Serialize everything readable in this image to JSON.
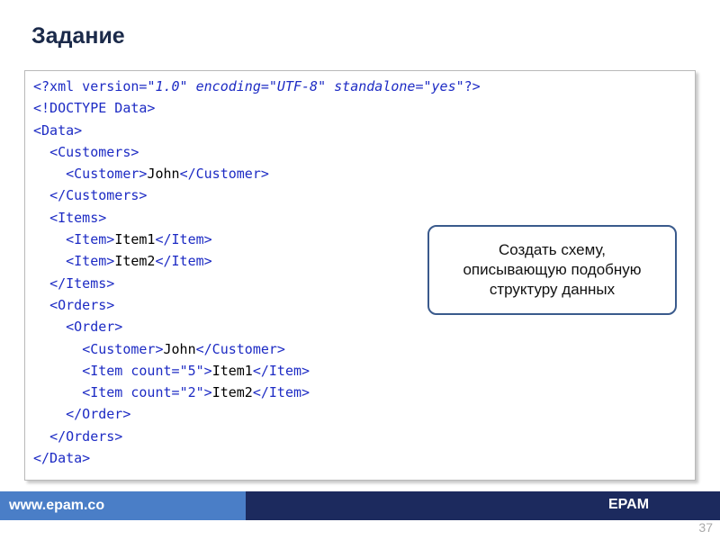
{
  "slide": {
    "title": "Задание",
    "page_number": "37"
  },
  "code": {
    "lines": [
      [
        {
          "t": "<?xml version=",
          "c": "tag"
        },
        {
          "t": "\"1.0\"",
          "c": "val"
        },
        {
          "t": " encoding=",
          "c": "attr"
        },
        {
          "t": "\"UTF-8\"",
          "c": "val"
        },
        {
          "t": " standalone=",
          "c": "attr"
        },
        {
          "t": "\"yes\"",
          "c": "val"
        },
        {
          "t": "?>",
          "c": "tag"
        }
      ],
      [
        {
          "t": "<!DOCTYPE Data>",
          "c": "tag"
        }
      ],
      [
        {
          "t": "<Data>",
          "c": "tag"
        }
      ],
      [
        {
          "t": "  ",
          "c": "text"
        },
        {
          "t": "<Customers>",
          "c": "tag"
        }
      ],
      [
        {
          "t": "    ",
          "c": "text"
        },
        {
          "t": "<Customer>",
          "c": "tag"
        },
        {
          "t": "John",
          "c": "text"
        },
        {
          "t": "</Customer>",
          "c": "tag"
        }
      ],
      [
        {
          "t": "  ",
          "c": "text"
        },
        {
          "t": "</Customers>",
          "c": "tag"
        }
      ],
      [
        {
          "t": "  ",
          "c": "text"
        },
        {
          "t": "<Items>",
          "c": "tag"
        }
      ],
      [
        {
          "t": "    ",
          "c": "text"
        },
        {
          "t": "<Item>",
          "c": "tag"
        },
        {
          "t": "Item1",
          "c": "text"
        },
        {
          "t": "</Item>",
          "c": "tag"
        }
      ],
      [
        {
          "t": "    ",
          "c": "text"
        },
        {
          "t": "<Item>",
          "c": "tag"
        },
        {
          "t": "Item2",
          "c": "text"
        },
        {
          "t": "</Item>",
          "c": "tag"
        }
      ],
      [
        {
          "t": "  ",
          "c": "text"
        },
        {
          "t": "</Items>",
          "c": "tag"
        }
      ],
      [
        {
          "t": "  ",
          "c": "text"
        },
        {
          "t": "<Orders>",
          "c": "tag"
        }
      ],
      [
        {
          "t": "    ",
          "c": "text"
        },
        {
          "t": "<Order>",
          "c": "tag"
        }
      ],
      [
        {
          "t": "      ",
          "c": "text"
        },
        {
          "t": "<Customer>",
          "c": "tag"
        },
        {
          "t": "John",
          "c": "text"
        },
        {
          "t": "</Customer>",
          "c": "tag"
        }
      ],
      [
        {
          "t": "      ",
          "c": "text"
        },
        {
          "t": "<Item count=",
          "c": "tag"
        },
        {
          "t": "\"5\"",
          "c": "val"
        },
        {
          "t": ">",
          "c": "tag"
        },
        {
          "t": "Item1",
          "c": "text"
        },
        {
          "t": "</Item>",
          "c": "tag"
        }
      ],
      [
        {
          "t": "      ",
          "c": "text"
        },
        {
          "t": "<Item count=",
          "c": "tag"
        },
        {
          "t": "\"2\"",
          "c": "val"
        },
        {
          "t": ">",
          "c": "tag"
        },
        {
          "t": "Item2",
          "c": "text"
        },
        {
          "t": "</Item>",
          "c": "tag"
        }
      ],
      [
        {
          "t": "    ",
          "c": "text"
        },
        {
          "t": "</Order>",
          "c": "tag"
        }
      ],
      [
        {
          "t": "  ",
          "c": "text"
        },
        {
          "t": "</Orders>",
          "c": "tag"
        }
      ],
      [
        {
          "t": "</Data>",
          "c": "tag"
        }
      ]
    ]
  },
  "callout": {
    "line1": "Создать схему,",
    "line2": "описывающую подобную",
    "line3": "структуру данных"
  },
  "footer": {
    "url": "www.epam.co",
    "brand": "EPAM"
  },
  "colors": {
    "tag": "#1d2bc4",
    "text": "#000000",
    "footer_left": "#4a7ec7",
    "footer_right": "#1c2a5e"
  }
}
